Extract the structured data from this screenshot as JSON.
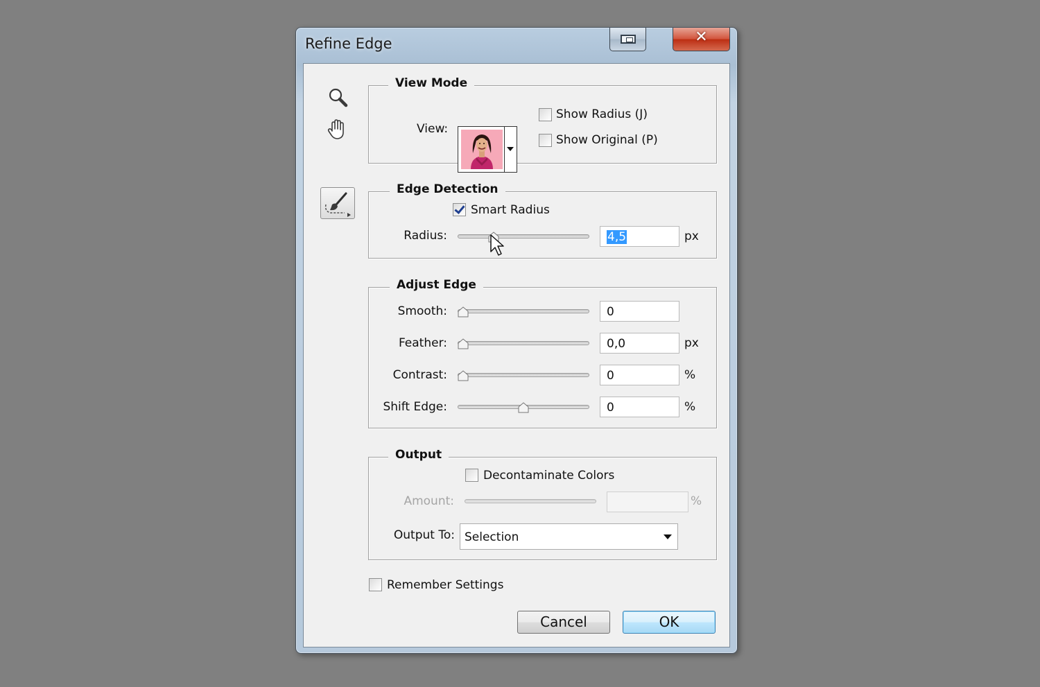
{
  "window": {
    "title": "Refine Edge",
    "close_glyph": "✕"
  },
  "tools": {
    "zoom_icon": "magnifier-icon",
    "hand_icon": "hand-icon",
    "brush_icon": "refine-radius-brush-icon"
  },
  "view_mode": {
    "legend": "View Mode",
    "view_label": "View:",
    "show_radius_label": "Show Radius (J)",
    "show_radius_checked": false,
    "show_original_label": "Show Original (P)",
    "show_original_checked": false
  },
  "edge_detection": {
    "legend": "Edge Detection",
    "smart_radius_label": "Smart Radius",
    "smart_radius_checked": true,
    "radius_label": "Radius:",
    "radius_value": "4,5",
    "radius_unit": "px",
    "radius_slider_fraction": 0.25
  },
  "adjust_edge": {
    "legend": "Adjust Edge",
    "smooth_label": "Smooth:",
    "smooth_value": "0",
    "smooth_slider_fraction": 0,
    "feather_label": "Feather:",
    "feather_value": "0,0",
    "feather_unit": "px",
    "feather_slider_fraction": 0,
    "contrast_label": "Contrast:",
    "contrast_value": "0",
    "contrast_unit": "%",
    "contrast_slider_fraction": 0,
    "shift_label": "Shift Edge:",
    "shift_value": "0",
    "shift_unit": "%",
    "shift_slider_fraction": 0.5
  },
  "output": {
    "legend": "Output",
    "decontaminate_label": "Decontaminate Colors",
    "decontaminate_checked": false,
    "amount_label": "Amount:",
    "amount_unit": "%",
    "output_to_label": "Output To:",
    "output_to_value": "Selection"
  },
  "footer": {
    "remember_label": "Remember Settings",
    "remember_checked": false,
    "cancel_label": "Cancel",
    "ok_label": "OK"
  },
  "colors": {
    "selection": "#3399ff",
    "window_frame": "#b9cde0",
    "close_button": "#c8381c"
  }
}
